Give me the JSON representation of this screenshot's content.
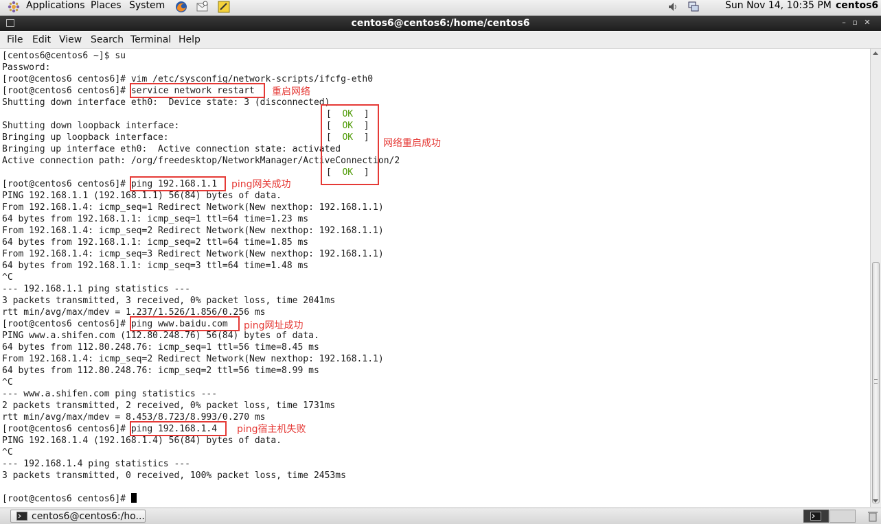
{
  "top_panel": {
    "menus": [
      "Applications",
      "Places",
      "System"
    ],
    "clock": "Sun Nov 14, 10:35 PM",
    "user": "centos6"
  },
  "window": {
    "title": "centos6@centos6:/home/centos6"
  },
  "menubar": {
    "items": [
      "File",
      "Edit",
      "View",
      "Search",
      "Terminal",
      "Help"
    ]
  },
  "terminal": {
    "lines": [
      "[centos6@centos6 ~]$ su",
      "Password:",
      "[root@centos6 centos6]# vim /etc/sysconfig/network-scripts/ifcfg-eth0",
      "[root@centos6 centos6]# service network restart",
      "Shutting down interface eth0:  Device state: 3 (disconnected)",
      "",
      "Shutting down loopback interface:",
      "Bringing up loopback interface:",
      "Bringing up interface eth0:  Active connection state: activated",
      "Active connection path: /org/freedesktop/NetworkManager/ActiveConnection/2",
      "",
      "[root@centos6 centos6]# ping 192.168.1.1",
      "PING 192.168.1.1 (192.168.1.1) 56(84) bytes of data.",
      "From 192.168.1.4: icmp_seq=1 Redirect Network(New nexthop: 192.168.1.1)",
      "64 bytes from 192.168.1.1: icmp_seq=1 ttl=64 time=1.23 ms",
      "From 192.168.1.4: icmp_seq=2 Redirect Network(New nexthop: 192.168.1.1)",
      "64 bytes from 192.168.1.1: icmp_seq=2 ttl=64 time=1.85 ms",
      "From 192.168.1.4: icmp_seq=3 Redirect Network(New nexthop: 192.168.1.1)",
      "64 bytes from 192.168.1.1: icmp_seq=3 ttl=64 time=1.48 ms",
      "^C",
      "--- 192.168.1.1 ping statistics ---",
      "3 packets transmitted, 3 received, 0% packet loss, time 2041ms",
      "rtt min/avg/max/mdev = 1.237/1.526/1.856/0.256 ms",
      "[root@centos6 centos6]# ping www.baidu.com",
      "PING www.a.shifen.com (112.80.248.76) 56(84) bytes of data.",
      "64 bytes from 112.80.248.76: icmp_seq=1 ttl=56 time=8.45 ms",
      "From 192.168.1.4: icmp_seq=2 Redirect Network(New nexthop: 192.168.1.1)",
      "64 bytes from 112.80.248.76: icmp_seq=2 ttl=56 time=8.99 ms",
      "^C",
      "--- www.a.shifen.com ping statistics ---",
      "2 packets transmitted, 2 received, 0% packet loss, time 1731ms",
      "rtt min/avg/max/mdev = 8.453/8.723/8.993/0.270 ms",
      "[root@centos6 centos6]# ping 192.168.1.4",
      "PING 192.168.1.4 (192.168.1.4) 56(84) bytes of data.",
      "^C",
      "--- 192.168.1.4 ping statistics ---",
      "3 packets transmitted, 0 received, 100% packet loss, time 2453ms",
      "",
      "[root@centos6 centos6]# "
    ],
    "ok_status": {
      "open": "[  ",
      "ok": "OK",
      "close": "  ]"
    }
  },
  "annotations": {
    "restart": "重启网络",
    "restart_success": "网络重启成功",
    "gateway": "ping网关成功",
    "website": "ping网址成功",
    "host": "ping宿主机失败"
  },
  "taskbar": {
    "task_label": "centos6@centos6:/ho..."
  },
  "colors": {
    "annotation": "#e53935",
    "ok": "#4e9a06"
  }
}
